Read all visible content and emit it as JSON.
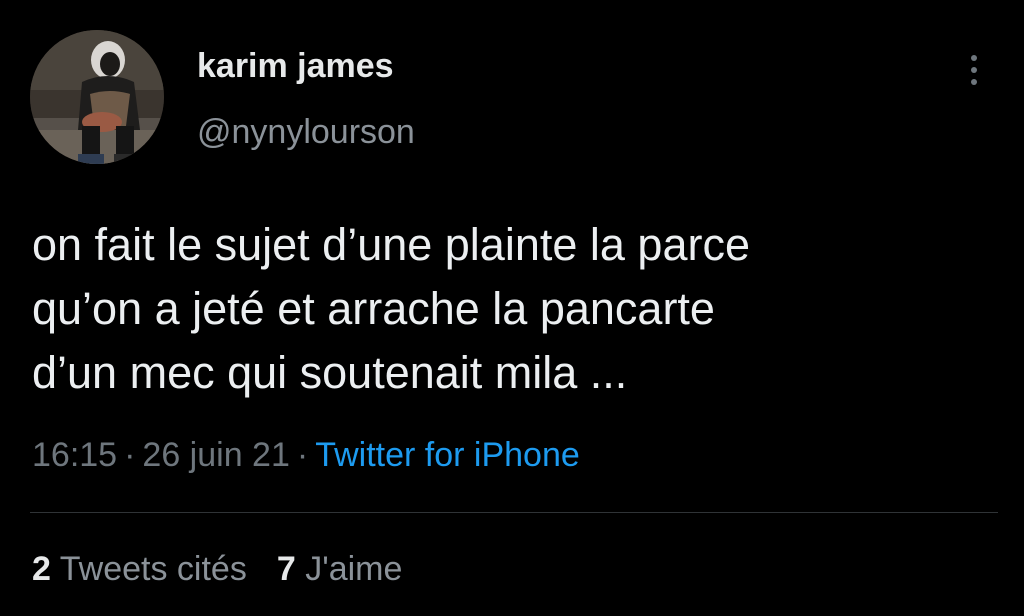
{
  "tweet": {
    "author": {
      "display_name": "karim james",
      "handle": "@nynylourson"
    },
    "text_lines": [
      "on fait le sujet d’une plainte la parce",
      "qu’on a jeté et arrache la pancarte",
      "d’un mec qui soutenait mila ..."
    ],
    "time": "16:15",
    "separator": "·",
    "date": "26 juin 21",
    "source": "Twitter for iPhone",
    "stats": {
      "quote_count": "2",
      "quote_label": "Tweets cités",
      "like_count": "7",
      "like_label": "J'aime"
    }
  },
  "icons": {
    "more": "more-vertical-icon"
  },
  "colors": {
    "background": "#000000",
    "primary_text": "#e7e9ea",
    "secondary_text": "#6e767d",
    "link": "#1d9bf0",
    "divider": "#2f3336"
  }
}
